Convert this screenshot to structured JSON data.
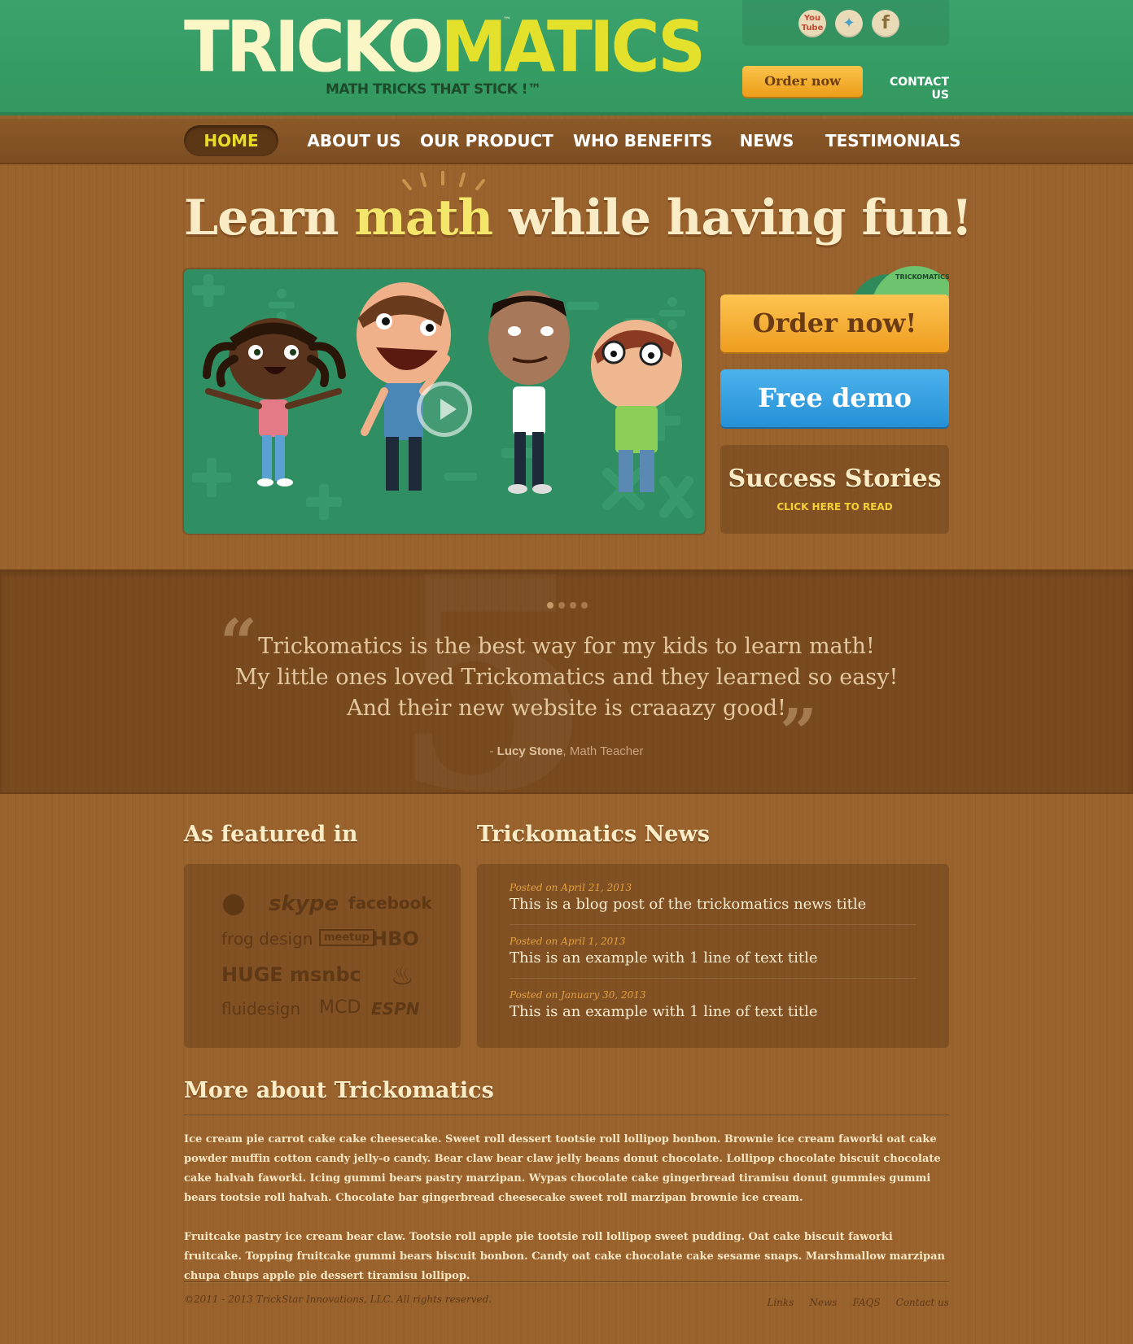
{
  "header": {
    "logo": {
      "part1": "TRICKO",
      "part2": "MATICS",
      "tm": "™",
      "tagline": "MATH TRICKS THAT STICK !™"
    },
    "social": [
      {
        "name": "youtube-icon",
        "glyph": "You\nTube"
      },
      {
        "name": "twitter-icon",
        "glyph": "🐦"
      },
      {
        "name": "facebook-icon",
        "glyph": "f"
      }
    ],
    "order_label": "Order now",
    "contact_label": "CONTACT US"
  },
  "nav": {
    "items": [
      {
        "label": "HOME",
        "active": true
      },
      {
        "label": "ABOUT US"
      },
      {
        "label": "OUR PRODUCT"
      },
      {
        "label": "WHO BENEFITS"
      },
      {
        "label": "NEWS"
      },
      {
        "label": "TESTIMONIALS"
      }
    ]
  },
  "hero": {
    "heading_pre": "Learn ",
    "heading_highlight": "math",
    "heading_post": " while having fun!",
    "dvd_label": "TRICKOMATICS",
    "order_button": "Order now!",
    "demo_button": "Free demo",
    "stories_title": "Success Stories",
    "stories_sub": "CLICK HERE TO READ"
  },
  "testimonial": {
    "lines": [
      "Trickomatics is the best way for my kids to learn math!",
      "My little ones loved Trickomatics and they learned so easy!",
      "And their new website is craaazy good!"
    ],
    "author_prefix": "- ",
    "author_name": "Lucy Stone",
    "author_role": ", Math Teacher",
    "open_quote": "“",
    "close_quote": "”"
  },
  "featured": {
    "title": "As featured in",
    "logos": [
      "apple",
      "skype",
      "facebook",
      "frog design",
      "meetup",
      "HBO",
      "HUGE",
      "msnbc",
      "helmet",
      "fluidesign",
      "MCD",
      "ESPN"
    ]
  },
  "news": {
    "title": "Trickomatics News",
    "items": [
      {
        "date": "Posted on April 21, 2013",
        "title": "This is a blog post of the trickomatics news title"
      },
      {
        "date": "Posted on April 1, 2013",
        "title": "This is an example with 1 line of text title"
      },
      {
        "date": "Posted on January 30, 2013",
        "title": "This is an example with 1 line of text title"
      }
    ]
  },
  "more": {
    "title": "More about Trickomatics",
    "para1": "Ice cream pie carrot cake cake cheesecake. Sweet roll dessert tootsie roll lollipop bonbon. Brownie ice cream faworki oat cake powder muffin cotton candy jelly-o candy. Bear claw bear claw jelly beans donut chocolate. Lollipop chocolate biscuit chocolate cake halvah faworki. Icing gummi bears pastry marzipan. Wypas chocolate cake gingerbread tiramisu donut gummies gummi bears tootsie roll halvah. Chocolate bar gingerbread cheesecake sweet roll marzipan brownie ice cream.",
    "para2": "Fruitcake pastry ice cream bear claw. Tootsie roll apple pie tootsie roll lollipop sweet pudding. Oat cake biscuit faworki fruitcake. Topping fruitcake gummi bears biscuit bonbon. Candy oat cake chocolate cake sesame snaps. Marshmallow marzipan chupa chups apple pie dessert tiramisu lollipop."
  },
  "footer": {
    "copyright": "©2011 - 2013 TrickStar Innovations, LLC. All rights reserved.",
    "links": [
      "Links",
      "News",
      "FAQS",
      "Contact us"
    ]
  },
  "colors": {
    "header_green": "#36a065",
    "wood": "#9a632e",
    "order_orange": "#f5b034",
    "demo_blue": "#36a0e0",
    "logo_yellow": "#e4e12c"
  }
}
